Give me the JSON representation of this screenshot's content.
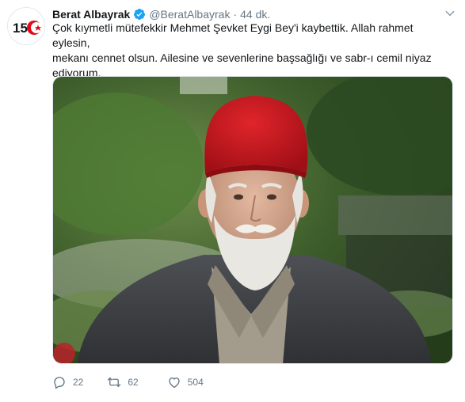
{
  "tweet": {
    "author_name": "Berat Albayrak",
    "handle": "@BeratAlbayrak",
    "separator": "·",
    "time": "44 dk.",
    "text": "Çok kıymetli mütefekkir Mehmet Şevket Eygi Bey'i kaybettik. Allah rahmet eylesin,\nmekanı cennet olsun. Ailesine ve sevenlerine başsağlığı ve sabr-ı cemil niyaz\nediyorum.",
    "avatar_logo_text": "15",
    "replies": "22",
    "retweets": "62",
    "likes": "504"
  },
  "colors": {
    "accent": "#1da1f2",
    "secondary_text": "#657786",
    "avatar_red": "#e30a17"
  },
  "icons": {
    "verified": "verified-badge-icon",
    "caret": "chevron-down-icon",
    "reply": "reply-icon",
    "retweet": "retweet-icon",
    "like": "heart-icon"
  }
}
